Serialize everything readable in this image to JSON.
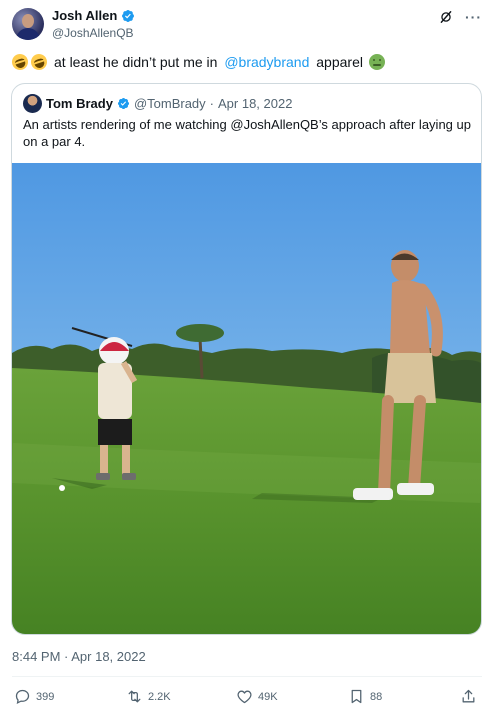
{
  "author": {
    "name": "Josh Allen",
    "handle": "@JoshAllenQB"
  },
  "tweet": {
    "text_main": "at least he didn’t put me in ",
    "mention": "@bradybrand",
    "text_end": " apparel",
    "emojis": [
      "rolling-on-floor-laughing",
      "rolling-on-floor-laughing",
      "nauseated-face"
    ]
  },
  "quoted": {
    "name": "Tom Brady",
    "handle": "@TomBrady",
    "separator": "·",
    "date": "Apr 18, 2022",
    "text": "An artists rendering of me watching @JoshAllenQB’s approach after laying up on a par 4."
  },
  "timestamp": "8:44 PM · Apr 18, 2022",
  "actions": {
    "replies": "399",
    "reposts": "2.2K",
    "likes": "49K",
    "bookmarks": "88"
  },
  "colors": {
    "accent": "#1d9bf0",
    "secondary_text": "#536471",
    "border": "#cfd9de"
  }
}
